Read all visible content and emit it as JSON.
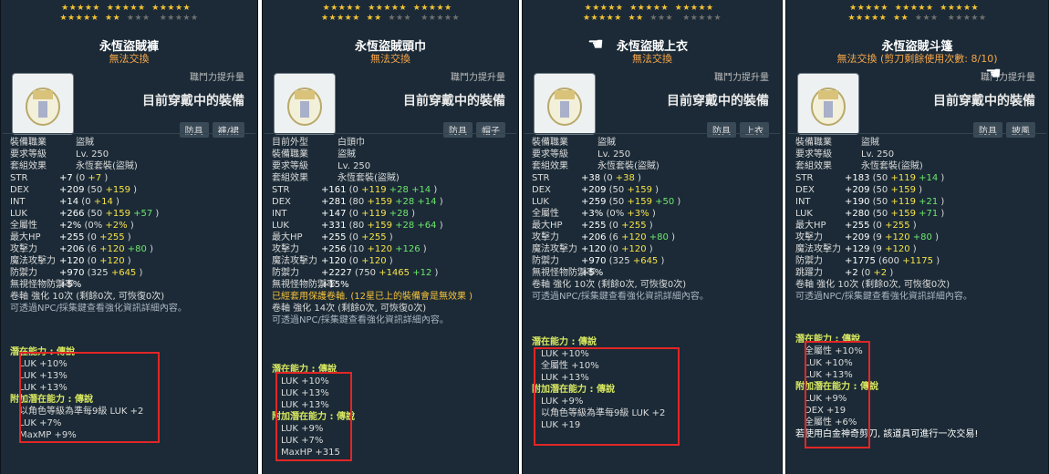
{
  "panels": [
    {
      "name": "永恆盜賊褲",
      "trade": "無法交換",
      "boost": "職鬥力提升量",
      "wearing": "目前穿戴中的裝備",
      "chips": [
        "防具",
        "褲/裙"
      ],
      "info": [
        [
          "裝備職業",
          "盜賊"
        ],
        [
          "要求等級",
          "Lv. 250"
        ]
      ],
      "set": "套組效果",
      "set_name": "永恆套裝(盜賊)",
      "stats": [
        {
          "l": "STR",
          "v": "+7",
          "b": "(0 ",
          "p": [
            "+7"
          ]
        },
        {
          "l": "DEX",
          "v": "+209",
          "b": "(50 ",
          "p": [
            "+159"
          ]
        },
        {
          "l": "INT",
          "v": "+14",
          "b": "(0 ",
          "p": [
            "+14"
          ]
        },
        {
          "l": "LUK",
          "v": "+266",
          "b": "(50 ",
          "p": [
            "+159",
            "+57"
          ]
        },
        {
          "l": "全屬性",
          "v": "+2%",
          "b": "(0% ",
          "p": [
            "+2%"
          ]
        },
        {
          "l": "最大HP",
          "v": "+255",
          "b": "(0 ",
          "p": [
            "+255"
          ]
        },
        {
          "l": "攻擊力",
          "v": "+206",
          "b": "(6 ",
          "p": [
            "+120",
            "+80"
          ]
        },
        {
          "l": "魔法攻擊力",
          "v": "+120",
          "b": "(0 ",
          "p": [
            "+120"
          ]
        },
        {
          "l": "防禦力",
          "v": "+970",
          "b": "(325 ",
          "p": [
            "+645"
          ]
        },
        {
          "l": "無視怪物防禦率",
          "v": "+5%",
          "b": "",
          "p": []
        }
      ],
      "scroll": "卷軸 強化 10次 (剩餘0次, 可恢復0次)",
      "scroll_note": "可透過NPC/採集鍵查看強化資訊詳細內容。",
      "pot_title": "潛在能力 : 傳說",
      "pot": [
        "LUK +10%",
        "LUK +13%",
        "LUK +13%"
      ],
      "bpot_title": "附加潛在能力 : 傳說",
      "bpot": [
        "以角色等級為準每9級 LUK +2",
        "LUK +7%",
        "MaxMP +9%"
      ]
    },
    {
      "name": "永恆盜賊頭巾",
      "trade": "無法交換",
      "boost": "職鬥力提升量",
      "wearing": "目前穿戴中的裝備",
      "chips": [
        "防具",
        "帽子"
      ],
      "info": [
        [
          "目前外型",
          "白頭巾"
        ],
        [
          "裝備職業",
          "盜賊"
        ],
        [
          "要求等級",
          "Lv. 250"
        ]
      ],
      "set": "套組效果",
      "set_name": "永恆套裝(盜賊)",
      "stats": [
        {
          "l": "STR",
          "v": "+161",
          "b": "(0 ",
          "p": [
            "+119",
            "+28",
            "+14"
          ]
        },
        {
          "l": "DEX",
          "v": "+281",
          "b": "(80 ",
          "p": [
            "+159",
            "+28",
            "+14"
          ]
        },
        {
          "l": "INT",
          "v": "+147",
          "b": "(0 ",
          "p": [
            "+119",
            "+28"
          ]
        },
        {
          "l": "LUK",
          "v": "+331",
          "b": "(80 ",
          "p": [
            "+159",
            "+28",
            "+64"
          ]
        },
        {
          "l": "最大HP",
          "v": "+255",
          "b": "(0 ",
          "p": [
            "+255"
          ]
        },
        {
          "l": "攻擊力",
          "v": "+256",
          "b": "(10 ",
          "p": [
            "+120",
            "+126"
          ]
        },
        {
          "l": "魔法攻擊力",
          "v": "+120",
          "b": "(0 ",
          "p": [
            "+120"
          ]
        },
        {
          "l": "防禦力",
          "v": "+2227",
          "b": "(750 ",
          "p": [
            "+1465",
            "+12"
          ]
        },
        {
          "l": "無視怪物防禦率",
          "v": "+15%",
          "b": "",
          "p": []
        }
      ],
      "warn": "已經套用保護卷軸. (12星已上的裝備會是無效果 )",
      "scroll": "卷軸 強化 14次 (剩餘0次, 可恢復0次)",
      "scroll_note": "可透過NPC/採集鍵查看強化資訊詳細內容。",
      "pot_title": "潛在能力 : 傳說",
      "pot": [
        "LUK +10%",
        "LUK +13%",
        "LUK +13%"
      ],
      "bpot_title": "附加潛在能力 : 傳說",
      "bpot": [
        "LUK +9%",
        "LUK +7%",
        "MaxHP +315"
      ]
    },
    {
      "name": "永恆盜賊上衣",
      "trade": "無法交換",
      "boost": "職鬥力提升量",
      "wearing": "目前穿戴中的裝備",
      "chips": [
        "防具",
        "上衣"
      ],
      "info": [
        [
          "裝備職業",
          "盜賊"
        ],
        [
          "要求等級",
          "Lv. 250"
        ]
      ],
      "set": "套組效果",
      "set_name": "永恆套裝(盜賊)",
      "stats": [
        {
          "l": "STR",
          "v": "+38",
          "b": "(0 ",
          "p": [
            "+38"
          ]
        },
        {
          "l": "DEX",
          "v": "+209",
          "b": "(50 ",
          "p": [
            "+159"
          ]
        },
        {
          "l": "LUK",
          "v": "+259",
          "b": "(50 ",
          "p": [
            "+159",
            "+50"
          ]
        },
        {
          "l": "全屬性",
          "v": "+3%",
          "b": "(0% ",
          "p": [
            "+3%"
          ]
        },
        {
          "l": "最大HP",
          "v": "+255",
          "b": "(0 ",
          "p": [
            "+255"
          ]
        },
        {
          "l": "攻擊力",
          "v": "+206",
          "b": "(6 ",
          "p": [
            "+120",
            "+80"
          ]
        },
        {
          "l": "魔法攻擊力",
          "v": "+120",
          "b": "(0 ",
          "p": [
            "+120"
          ]
        },
        {
          "l": "防禦力",
          "v": "+970",
          "b": "(325 ",
          "p": [
            "+645"
          ]
        },
        {
          "l": "無視怪物防禦率",
          "v": "+5%",
          "b": "",
          "p": []
        }
      ],
      "scroll": "卷軸 強化 10次 (剩餘0次, 可恢復0次)",
      "scroll_note": "可透過NPC/採集鍵查看強化資訊詳細內容。",
      "pot_title": "潛在能力 : 傳說",
      "pot": [
        "LUK +10%",
        "全屬性 +10%",
        "LUK +13%"
      ],
      "bpot_title": "附加潛在能力 : 傳說",
      "bpot": [
        "LUK +9%",
        "以角色等級為準每9級 LUK +2",
        "LUK +19"
      ]
    },
    {
      "name": "永恆盜賊斗篷",
      "trade": "無法交換 (剪刀剩餘使用次數: 8/10)",
      "boost": "職鬥力提升量",
      "wearing": "目前穿戴中的裝備",
      "chips": [
        "防具",
        "披風"
      ],
      "info": [
        [
          "裝備職業",
          "盜賊"
        ],
        [
          "要求等級",
          "Lv. 250"
        ]
      ],
      "set": "套組效果",
      "set_name": "永恆套裝(盜賊)",
      "stats": [
        {
          "l": "STR",
          "v": "+183",
          "b": "(50 ",
          "p": [
            "+119",
            "+14"
          ]
        },
        {
          "l": "DEX",
          "v": "+209",
          "b": "(50 ",
          "p": [
            "+159"
          ]
        },
        {
          "l": "INT",
          "v": "+190",
          "b": "(50 ",
          "p": [
            "+119",
            "+21"
          ]
        },
        {
          "l": "LUK",
          "v": "+280",
          "b": "(50 ",
          "p": [
            "+159",
            "+71"
          ]
        },
        {
          "l": "最大HP",
          "v": "+255",
          "b": "(0 ",
          "p": [
            "+255"
          ]
        },
        {
          "l": "攻擊力",
          "v": "+209",
          "b": "(9 ",
          "p": [
            "+120",
            "+80"
          ]
        },
        {
          "l": "魔法攻擊力",
          "v": "+129",
          "b": "(9 ",
          "p": [
            "+120"
          ]
        },
        {
          "l": "防禦力",
          "v": "+1775",
          "b": "(600 ",
          "p": [
            "+1175"
          ]
        },
        {
          "l": "跳躍力",
          "v": "+2",
          "b": "(0 ",
          "p": [
            "+2"
          ]
        }
      ],
      "scroll": "卷軸 強化 10次 (剩餘0次, 可恢復0次)",
      "scroll_note": "可透過NPC/採集鍵查看強化資訊詳細內容。",
      "pot_title": "潛在能力 : 傳說",
      "pot": [
        "全屬性 +10%",
        "LUK +10%",
        "LUK +13%"
      ],
      "bpot_title": "附加潛在能力 : 傳說",
      "bpot": [
        "LUK +9%",
        "DEX +19",
        "全屬性 +6%"
      ],
      "footer": "若使用白金神奇剪刀, 該道具可進行一次交易!"
    }
  ],
  "star_rows": [
    [
      "★★★★★",
      "★★★★★",
      "★★★★★"
    ],
    [
      "★★★★★",
      "★★"
    ]
  ]
}
